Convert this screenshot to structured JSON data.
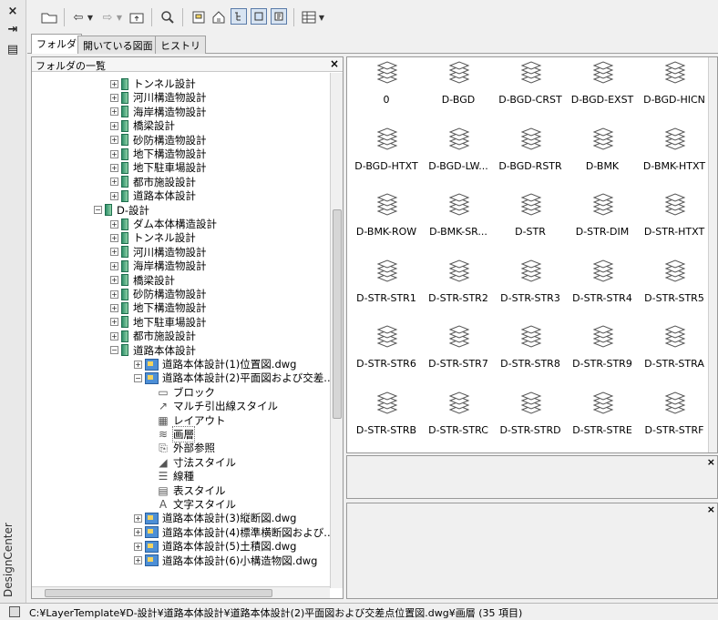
{
  "app": {
    "title": "DesignCenter"
  },
  "strip": {
    "close": "×",
    "autohide": "⇥",
    "props": "▤"
  },
  "toolbar": {
    "items": [
      "open-folder-icon",
      "back-icon",
      "back-dropdown-icon",
      "forward-icon",
      "forward-dropdown-icon",
      "up-icon",
      "search-icon",
      "favorites-icon",
      "home-icon",
      "tree-toggle-icon",
      "preview-icon",
      "description-icon",
      "views-icon",
      "views-dropdown-icon"
    ]
  },
  "tabs": [
    {
      "label": "フォルダ",
      "active": true
    },
    {
      "label": "開いている図面",
      "active": false
    },
    {
      "label": "ヒストリ",
      "active": false
    }
  ],
  "tree": {
    "header": "フォルダの一覧",
    "close": "×",
    "nodes": [
      {
        "text": "トンネル設計",
        "indent": 1,
        "kind": "folder",
        "exp": "+"
      },
      {
        "text": "河川構造物設計",
        "indent": 1,
        "kind": "folder",
        "exp": "+"
      },
      {
        "text": "海岸構造物設計",
        "indent": 1,
        "kind": "folder",
        "exp": "+"
      },
      {
        "text": "橋梁設計",
        "indent": 1,
        "kind": "folder",
        "exp": "+"
      },
      {
        "text": "砂防構造物設計",
        "indent": 1,
        "kind": "folder",
        "exp": "+"
      },
      {
        "text": "地下構造物設計",
        "indent": 1,
        "kind": "folder",
        "exp": "+"
      },
      {
        "text": "地下駐車場設計",
        "indent": 1,
        "kind": "folder",
        "exp": "+"
      },
      {
        "text": "都市施設設計",
        "indent": 1,
        "kind": "folder",
        "exp": "+"
      },
      {
        "text": "道路本体設計",
        "indent": 1,
        "kind": "folder",
        "exp": "+"
      },
      {
        "text": "D-設計",
        "indent": 0,
        "kind": "folder",
        "exp": "−"
      },
      {
        "text": "ダム本体構造設計",
        "indent": 1,
        "kind": "folder",
        "exp": "+"
      },
      {
        "text": "トンネル設計",
        "indent": 1,
        "kind": "folder",
        "exp": "+"
      },
      {
        "text": "河川構造物設計",
        "indent": 1,
        "kind": "folder",
        "exp": "+"
      },
      {
        "text": "海岸構造物設計",
        "indent": 1,
        "kind": "folder",
        "exp": "+"
      },
      {
        "text": "橋梁設計",
        "indent": 1,
        "kind": "folder",
        "exp": "+"
      },
      {
        "text": "砂防構造物設計",
        "indent": 1,
        "kind": "folder",
        "exp": "+"
      },
      {
        "text": "地下構造物設計",
        "indent": 1,
        "kind": "folder",
        "exp": "+"
      },
      {
        "text": "地下駐車場設計",
        "indent": 1,
        "kind": "folder",
        "exp": "+"
      },
      {
        "text": "都市施設設計",
        "indent": 1,
        "kind": "folder",
        "exp": "+"
      },
      {
        "text": "道路本体設計",
        "indent": 1,
        "kind": "folder",
        "exp": "−"
      },
      {
        "text": "道路本体設計(1)位置図.dwg",
        "indent": 2,
        "kind": "dwg",
        "exp": "+"
      },
      {
        "text": "道路本体設計(2)平面図および交差...",
        "indent": 2,
        "kind": "dwg",
        "exp": "−"
      },
      {
        "text": "ブロック",
        "indent": 3,
        "kind": "sub",
        "icon": "▭"
      },
      {
        "text": "マルチ引出線スタイル",
        "indent": 3,
        "kind": "sub",
        "icon": "↗"
      },
      {
        "text": "レイアウト",
        "indent": 3,
        "kind": "sub",
        "icon": "▦"
      },
      {
        "text": "画層",
        "indent": 3,
        "kind": "sub",
        "icon": "≋"
      },
      {
        "text": "外部参照",
        "indent": 3,
        "kind": "sub",
        "icon": "⎘"
      },
      {
        "text": "寸法スタイル",
        "indent": 3,
        "kind": "sub",
        "icon": "◢"
      },
      {
        "text": "線種",
        "indent": 3,
        "kind": "sub",
        "icon": "☰"
      },
      {
        "text": "表スタイル",
        "indent": 3,
        "kind": "sub",
        "icon": "▤"
      },
      {
        "text": "文字スタイル",
        "indent": 3,
        "kind": "sub",
        "icon": "A"
      },
      {
        "text": "道路本体設計(3)縦断図.dwg",
        "indent": 2,
        "kind": "dwg",
        "exp": "+"
      },
      {
        "text": "道路本体設計(4)標準横断図および...",
        "indent": 2,
        "kind": "dwg",
        "exp": "+"
      },
      {
        "text": "道路本体設計(5)土積図.dwg",
        "indent": 2,
        "kind": "dwg",
        "exp": "+"
      },
      {
        "text": "道路本体設計(6)小構造物図.dwg",
        "indent": 2,
        "kind": "dwg",
        "exp": "+"
      }
    ]
  },
  "layers": [
    "0",
    "D-BGD",
    "D-BGD-CRST",
    "D-BGD-EXST",
    "D-BGD-HICN",
    "D-BGD-HTXT",
    "D-BGD-LW...",
    "D-BGD-RSTR",
    "D-BMK",
    "D-BMK-HTXT",
    "D-BMK-ROW",
    "D-BMK-SR...",
    "D-STR",
    "D-STR-DIM",
    "D-STR-HTXT",
    "D-STR-STR1",
    "D-STR-STR2",
    "D-STR-STR3",
    "D-STR-STR4",
    "D-STR-STR5",
    "D-STR-STR6",
    "D-STR-STR7",
    "D-STR-STR8",
    "D-STR-STR9",
    "D-STR-STRA",
    "D-STR-STRB",
    "D-STR-STRC",
    "D-STR-STRD",
    "D-STR-STRE",
    "D-STR-STRF"
  ],
  "panels": {
    "preview_close": "×",
    "desc_close": "×"
  },
  "status": {
    "text": "C:¥LayerTemplate¥D-設計¥道路本体設計¥道路本体設計(2)平面図および交差点位置図.dwg¥画層 (35 項目)"
  }
}
